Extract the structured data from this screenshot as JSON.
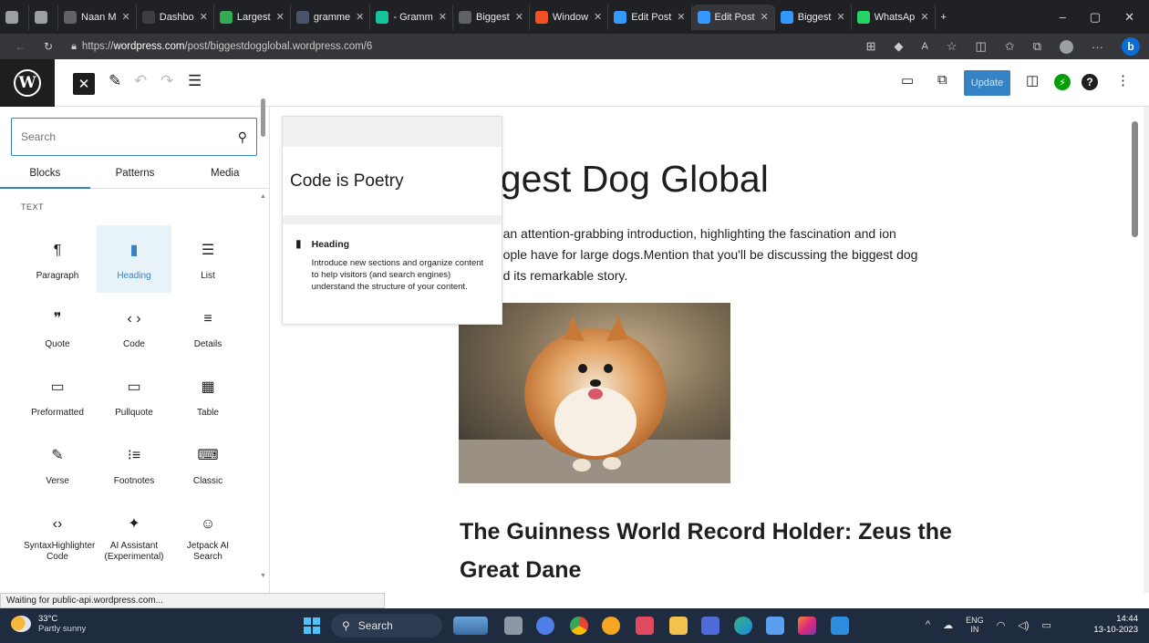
{
  "browser": {
    "tabs": [
      {
        "label": "",
        "color": "#9aa0a6"
      },
      {
        "label": "",
        "color": "#9aa0a6"
      },
      {
        "label": "Naan M",
        "color": "#5f6368"
      },
      {
        "label": "Dashbo",
        "color": "#3c4043"
      },
      {
        "label": "Largest",
        "color": "#34a853"
      },
      {
        "label": "gramme",
        "color": "#4a5368"
      },
      {
        "label": "- Gramm",
        "color": "#15c39a"
      },
      {
        "label": "Biggest",
        "color": "#5f6368"
      },
      {
        "label": "Window",
        "color": "#f25022"
      },
      {
        "label": "Edit Post",
        "color": "#3399ff"
      },
      {
        "label": "Edit Post",
        "color": "#3399ff"
      },
      {
        "label": "Biggest",
        "color": "#3399ff"
      },
      {
        "label": "WhatsAp",
        "color": "#25d366"
      }
    ],
    "active_tab_index": 10,
    "url_prefix": "https://",
    "url_domain": "wordpress.com",
    "url_path": "/post/biggestdogglobal.wordpress.com/6"
  },
  "editor": {
    "update_label": "Update"
  },
  "inserter": {
    "search_placeholder": "Search",
    "tabs": [
      "Blocks",
      "Patterns",
      "Media"
    ],
    "category": "TEXT",
    "blocks": [
      {
        "label": "Paragraph",
        "icon": "¶"
      },
      {
        "label": "Heading",
        "icon": "▮"
      },
      {
        "label": "List",
        "icon": "☰"
      },
      {
        "label": "Quote",
        "icon": "❞"
      },
      {
        "label": "Code",
        "icon": "‹ ›"
      },
      {
        "label": "Details",
        "icon": "≡"
      },
      {
        "label": "Preformatted",
        "icon": "▭"
      },
      {
        "label": "Pullquote",
        "icon": "▭"
      },
      {
        "label": "Table",
        "icon": "▦"
      },
      {
        "label": "Verse",
        "icon": "✎"
      },
      {
        "label": "Footnotes",
        "icon": "⁝≡"
      },
      {
        "label": "Classic",
        "icon": "⌨"
      },
      {
        "label": "SyntaxHighlighter Code",
        "icon": "‹›"
      },
      {
        "label": "AI Assistant (Experimental)",
        "icon": "✦"
      },
      {
        "label": "Jetpack AI Search",
        "icon": "☺"
      }
    ],
    "highlighted_block": "Heading"
  },
  "preview": {
    "sample_text": "Code is Poetry",
    "title": "Heading",
    "description": "Introduce new sections and organize content to help visitors (and search engines) understand the structure of your content."
  },
  "post": {
    "title": "ggest Dog Global",
    "intro": "th an attention-grabbing introduction, highlighting the fascination and ion people have for large dogs.Mention that you'll be discussing the biggest dog and its remarkable story.",
    "heading": "The Guinness World Record Holder: Zeus the Great Dane"
  },
  "status_text": "Waiting for public-api.wordpress.com...",
  "taskbar": {
    "temp": "33°C",
    "weather": "Partly sunny",
    "search_label": "Search",
    "lang_top": "ENG",
    "lang_bottom": "IN",
    "time": "14:44",
    "date": "13-10-2023"
  }
}
